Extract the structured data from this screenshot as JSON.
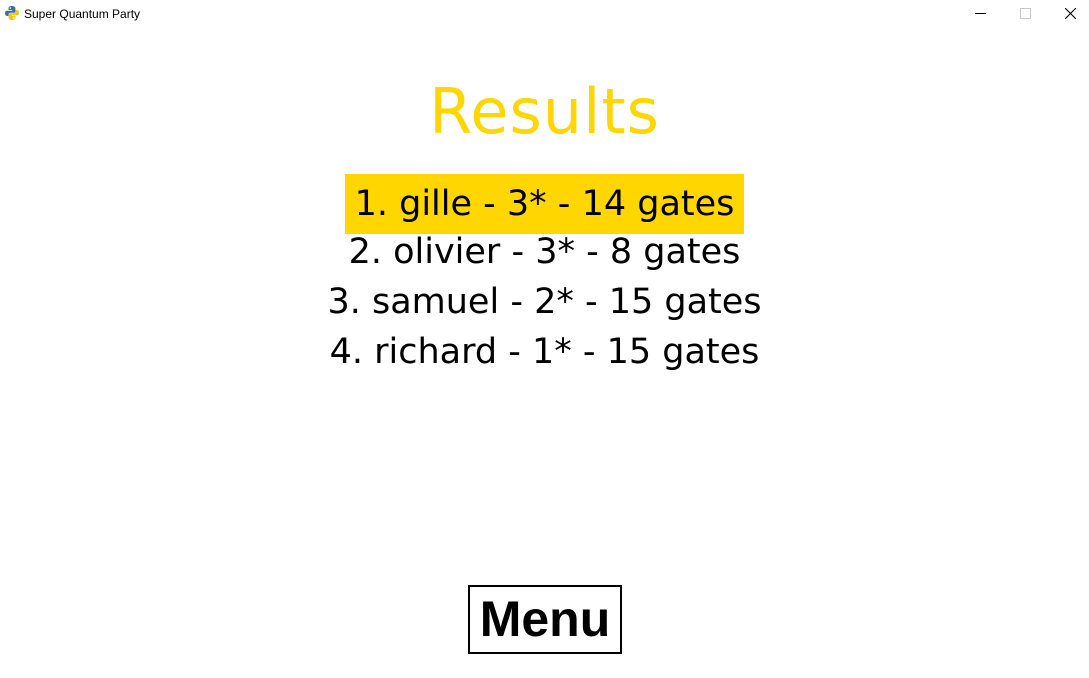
{
  "window": {
    "title": "Super Quantum Party",
    "icon": "python-icon"
  },
  "screen": {
    "title": "Results",
    "title_color": "#ffd600",
    "highlight_color": "#ffd600",
    "results": [
      {
        "text": "1. gille - 3* - 14 gates",
        "highlighted": true
      },
      {
        "text": "2. olivier - 3* - 8 gates",
        "highlighted": false
      },
      {
        "text": "3. samuel - 2* - 15 gates",
        "highlighted": false
      },
      {
        "text": "4. richard - 1* - 15 gates",
        "highlighted": false
      }
    ],
    "menu_label": "Menu"
  }
}
